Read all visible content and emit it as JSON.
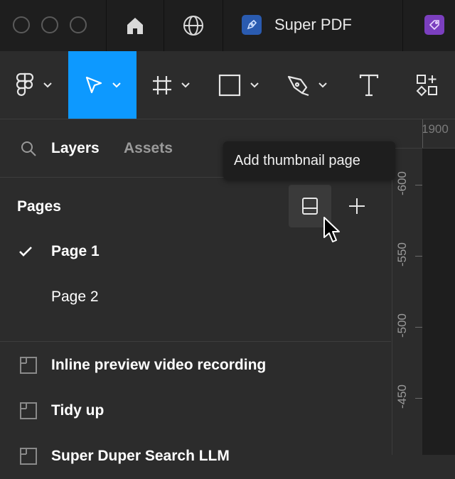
{
  "window": {
    "tab_title": "Super PDF"
  },
  "colors": {
    "accent": "#0d99ff",
    "plugin_purple": "#7b3fbf",
    "app_tab_icon_bg": "#2a5bb0"
  },
  "toolbar": {
    "tools": [
      "figma-menu",
      "move-tool",
      "frame-tool",
      "shape-tool",
      "pen-tool",
      "text-tool",
      "actions-tool"
    ],
    "active_tool": "move-tool"
  },
  "panel": {
    "tabs": [
      "Layers",
      "Assets"
    ],
    "active_tab": "Layers",
    "pages_heading": "Pages",
    "pages": [
      {
        "label": "Page 1",
        "selected": true
      },
      {
        "label": "Page 2",
        "selected": false
      }
    ],
    "layers": [
      {
        "label": "Inline preview video recording"
      },
      {
        "label": "Tidy up"
      },
      {
        "label": "Super Duper Search LLM"
      }
    ]
  },
  "tooltip": {
    "text": "Add thumbnail page"
  },
  "ruler": {
    "horizontal_label": "1900",
    "vertical_labels": [
      "-600",
      "-550",
      "-500",
      "-450"
    ]
  }
}
